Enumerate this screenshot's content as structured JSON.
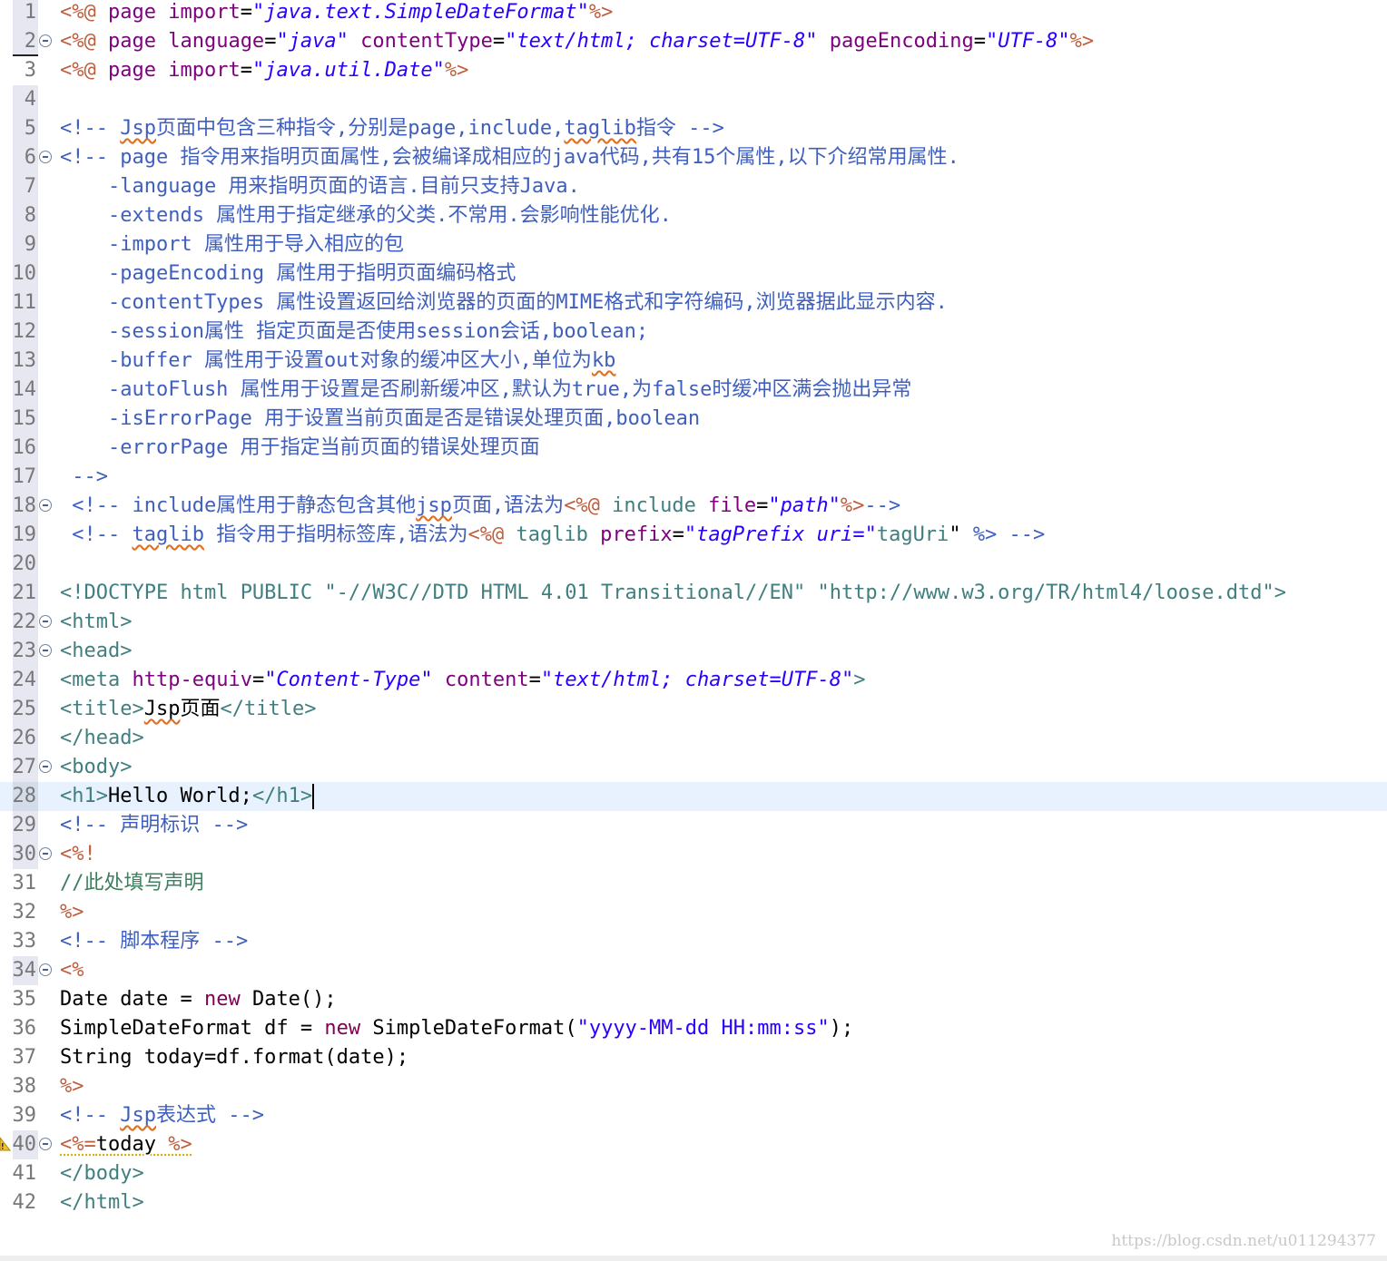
{
  "editor": {
    "current_line": 28,
    "watermark": "https://blog.csdn.net/u011294377",
    "lines": [
      {
        "n": "1",
        "fold": false,
        "tokens": [
          [
            "brown",
            "<%@ "
          ],
          [
            "purple",
            "page "
          ],
          [
            "purple",
            "import"
          ],
          [
            "dark",
            "="
          ],
          [
            "str",
            "\"java.text.SimpleDateFormat\""
          ],
          [
            "brown",
            "%>"
          ]
        ]
      },
      {
        "n": "2",
        "fold": true,
        "tokens": [
          [
            "brown",
            "<%@ "
          ],
          [
            "purple",
            "page "
          ],
          [
            "purple",
            "language"
          ],
          [
            "dark",
            "="
          ],
          [
            "str",
            "\"java\""
          ],
          [
            "dark",
            " "
          ],
          [
            "purple",
            "contentType"
          ],
          [
            "dark",
            "="
          ],
          [
            "str",
            "\"text/html; charset=UTF-8\""
          ],
          [
            "dark",
            " "
          ],
          [
            "purple",
            "pageEncoding"
          ],
          [
            "dark",
            "="
          ],
          [
            "str",
            "\"UTF-8\""
          ],
          [
            "brown",
            "%>"
          ]
        ]
      },
      {
        "n": "3",
        "fold": false,
        "tokens": [
          [
            "brown",
            "<%@ "
          ],
          [
            "purple",
            "page "
          ],
          [
            "purple",
            "import"
          ],
          [
            "dark",
            "="
          ],
          [
            "str",
            "\"java.util.Date\""
          ],
          [
            "brown",
            "%>"
          ]
        ]
      },
      {
        "n": "4",
        "fold": false,
        "tokens": []
      },
      {
        "n": "5",
        "fold": false,
        "tokens": [
          [
            "comment",
            "<!-- "
          ],
          [
            "commentsq",
            "Jsp"
          ],
          [
            "comment",
            "页面中包含三种指令,分别是page,include,"
          ],
          [
            "commentsq",
            "taglib"
          ],
          [
            "comment",
            "指令 -->"
          ]
        ]
      },
      {
        "n": "6",
        "fold": true,
        "tokens": [
          [
            "comment",
            "<!-- page 指令用来指明页面属性,会被编译成相应的java代码,共有15个属性,以下介绍常用属性."
          ]
        ]
      },
      {
        "n": "7",
        "fold": false,
        "tokens": [
          [
            "comment",
            "    -language 用来指明页面的语言.目前只支持Java."
          ]
        ]
      },
      {
        "n": "8",
        "fold": false,
        "tokens": [
          [
            "comment",
            "    -extends 属性用于指定继承的父类.不常用.会影响性能优化."
          ]
        ]
      },
      {
        "n": "9",
        "fold": false,
        "tokens": [
          [
            "comment",
            "    -import 属性用于导入相应的包"
          ]
        ]
      },
      {
        "n": "10",
        "fold": false,
        "tokens": [
          [
            "comment",
            "    -pageEncoding 属性用于指明页面编码格式"
          ]
        ]
      },
      {
        "n": "11",
        "fold": false,
        "tokens": [
          [
            "comment",
            "    -contentTypes 属性设置返回给浏览器的页面的MIME格式和字符编码,浏览器据此显示内容."
          ]
        ]
      },
      {
        "n": "12",
        "fold": false,
        "tokens": [
          [
            "comment",
            "    -session属性 指定页面是否使用session会话,boolean;"
          ]
        ]
      },
      {
        "n": "13",
        "fold": false,
        "tokens": [
          [
            "comment",
            "    -buffer 属性用于设置out对象的缓冲区大小,单位为"
          ],
          [
            "commentsq",
            "kb"
          ]
        ]
      },
      {
        "n": "14",
        "fold": false,
        "tokens": [
          [
            "comment",
            "    -autoFlush 属性用于设置是否刷新缓冲区,默认为true,为false时缓冲区满会抛出异常"
          ]
        ]
      },
      {
        "n": "15",
        "fold": false,
        "tokens": [
          [
            "comment",
            "    -isErrorPage 用于设置当前页面是否是错误处理页面,boolean"
          ]
        ]
      },
      {
        "n": "16",
        "fold": false,
        "tokens": [
          [
            "comment",
            "    -errorPage 用于指定当前页面的错误处理页面"
          ]
        ]
      },
      {
        "n": "17",
        "fold": false,
        "tokens": [
          [
            "comment",
            " -->"
          ]
        ]
      },
      {
        "n": "18",
        "fold": true,
        "tokens": [
          [
            "comment",
            " <!-- include属性用于静态包含其他"
          ],
          [
            "commentsq",
            "jsp"
          ],
          [
            "comment",
            "页面,语法为"
          ],
          [
            "brown",
            "<%@ "
          ],
          [
            "green",
            "include "
          ],
          [
            "purple",
            "file"
          ],
          [
            "dark",
            "="
          ],
          [
            "str",
            "\"path\""
          ],
          [
            "brown",
            "%>"
          ],
          [
            "comment",
            "-->"
          ]
        ]
      },
      {
        "n": "19",
        "fold": false,
        "tokens": [
          [
            "comment",
            " <!-- "
          ],
          [
            "commentsq",
            "taglib"
          ],
          [
            "comment",
            " 指令用于指明标签库,语法为"
          ],
          [
            "brown",
            "<%@ "
          ],
          [
            "green",
            "taglib "
          ],
          [
            "purple",
            "prefix"
          ],
          [
            "dark",
            "="
          ],
          [
            "str",
            "\"tagPrefix uri=\""
          ],
          [
            "green",
            "tagUri"
          ],
          [
            "dark",
            "\" "
          ],
          [
            "comment",
            "%> -->"
          ]
        ]
      },
      {
        "n": "20",
        "fold": false,
        "tokens": []
      },
      {
        "n": "21",
        "fold": false,
        "tokens": [
          [
            "green",
            "<!DOCTYPE html "
          ],
          [
            "gray",
            "PUBLIC "
          ],
          [
            "green",
            "\"-//W3C//DTD HTML 4.01 Transitional//EN\" \"http://www.w3.org/TR/html4/loose.dtd\">"
          ]
        ]
      },
      {
        "n": "22",
        "fold": true,
        "tokens": [
          [
            "green",
            "<html>"
          ]
        ]
      },
      {
        "n": "23",
        "fold": true,
        "tokens": [
          [
            "green",
            "<head>"
          ]
        ]
      },
      {
        "n": "24",
        "fold": false,
        "tokens": [
          [
            "green",
            "<meta "
          ],
          [
            "purple",
            "http-equiv"
          ],
          [
            "dark",
            "="
          ],
          [
            "str",
            "\"Content-Type\""
          ],
          [
            "dark",
            " "
          ],
          [
            "purple",
            "content"
          ],
          [
            "dark",
            "="
          ],
          [
            "str",
            "\"text/html; charset=UTF-8\""
          ],
          [
            "green",
            ">"
          ]
        ]
      },
      {
        "n": "25",
        "fold": false,
        "tokens": [
          [
            "green",
            "<title>"
          ],
          [
            "darksq",
            "Jsp"
          ],
          [
            "dark",
            "页面"
          ],
          [
            "green",
            "</title>"
          ]
        ]
      },
      {
        "n": "26",
        "fold": false,
        "tokens": [
          [
            "green",
            "</head>"
          ]
        ]
      },
      {
        "n": "27",
        "fold": true,
        "tokens": [
          [
            "green",
            "<body>"
          ]
        ]
      },
      {
        "n": "28",
        "fold": false,
        "tokens": [
          [
            "green",
            "<h1>"
          ],
          [
            "dark",
            "Hello World;"
          ],
          [
            "green",
            "</h1>"
          ]
        ]
      },
      {
        "n": "29",
        "fold": false,
        "tokens": [
          [
            "comment",
            "<!-- 声明标识 -->"
          ]
        ]
      },
      {
        "n": "30",
        "fold": true,
        "tokens": [
          [
            "brown",
            "<%!"
          ]
        ]
      },
      {
        "n": "31",
        "fold": false,
        "tokens": [
          [
            "jcomment",
            "//此处填写声明"
          ]
        ]
      },
      {
        "n": "32",
        "fold": false,
        "tokens": [
          [
            "brown",
            "%>"
          ]
        ]
      },
      {
        "n": "33",
        "fold": false,
        "tokens": [
          [
            "comment",
            "<!-- 脚本程序 -->"
          ]
        ]
      },
      {
        "n": "34",
        "fold": true,
        "tokens": [
          [
            "brown",
            "<%"
          ]
        ]
      },
      {
        "n": "35",
        "fold": false,
        "tokens": [
          [
            "dark",
            "Date date = "
          ],
          [
            "key",
            "new"
          ],
          [
            "dark",
            " Date();"
          ]
        ]
      },
      {
        "n": "36",
        "fold": false,
        "tokens": [
          [
            "dark",
            "SimpleDateFormat df = "
          ],
          [
            "key",
            "new"
          ],
          [
            "dark",
            " SimpleDateFormat("
          ],
          [
            "plainstr",
            "\"yyyy-MM-dd HH:mm:ss\""
          ],
          [
            "dark",
            ");"
          ]
        ]
      },
      {
        "n": "37",
        "fold": false,
        "tokens": [
          [
            "dark",
            "String today=df.format(date);"
          ]
        ]
      },
      {
        "n": "38",
        "fold": false,
        "tokens": [
          [
            "brown",
            "%>"
          ]
        ]
      },
      {
        "n": "39",
        "fold": false,
        "tokens": [
          [
            "comment",
            "<!-- "
          ],
          [
            "commentsq",
            "Jsp"
          ],
          [
            "comment",
            "表达式 -->"
          ]
        ]
      },
      {
        "n": "40",
        "fold": true,
        "warn": true,
        "tokens": [
          [
            "brownwarn",
            "<%="
          ],
          [
            "darkwarn",
            "today "
          ],
          [
            "brownwarn",
            "%>"
          ]
        ]
      },
      {
        "n": "41",
        "fold": false,
        "tokens": [
          [
            "green",
            "</body>"
          ]
        ]
      },
      {
        "n": "42",
        "fold": false,
        "tokens": [
          [
            "green",
            "</html>"
          ]
        ]
      }
    ]
  }
}
